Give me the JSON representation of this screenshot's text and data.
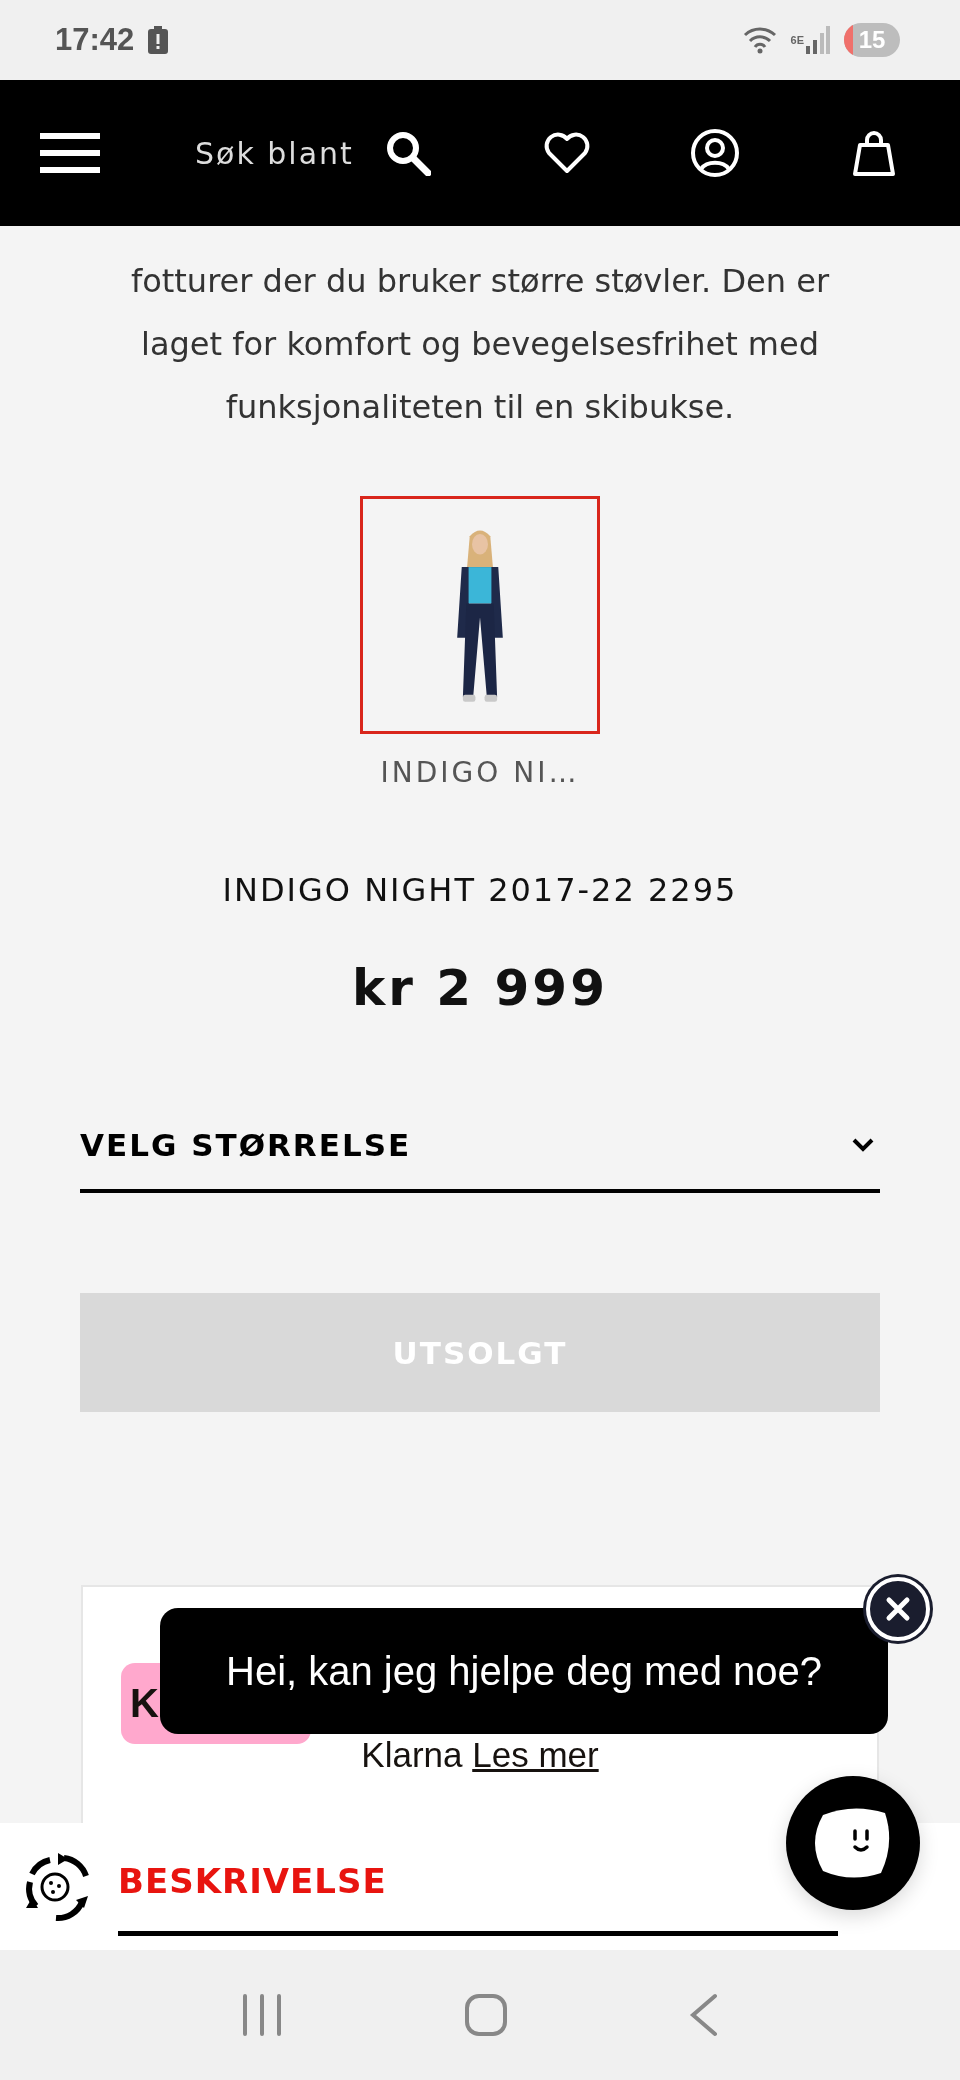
{
  "status_bar": {
    "time": "17:42",
    "wifi_label": "6E",
    "battery": "15"
  },
  "header": {
    "search_placeholder": "Søk blant"
  },
  "description": "fotturer der du bruker større støvler. Den er laget for komfort og bevegelsesfrihet med funksjonaliteten til en skibukse.",
  "variants": [
    {
      "label": "INDIGO NI…",
      "selected": true
    }
  ],
  "product": {
    "name": "INDIGO NIGHT 2017-22 2295",
    "price": "kr 2 999"
  },
  "size_select": {
    "label": "VELG STØRRELSE"
  },
  "add_button": {
    "label": "UTSOLGT",
    "disabled": true
  },
  "klarna": {
    "badge": "K",
    "text": "Klarna",
    "link": "Les mer"
  },
  "chat": {
    "message": "Hei, kan jeg hjelpe deg med noe?"
  },
  "section": {
    "title": "BESKRIVELSE"
  }
}
